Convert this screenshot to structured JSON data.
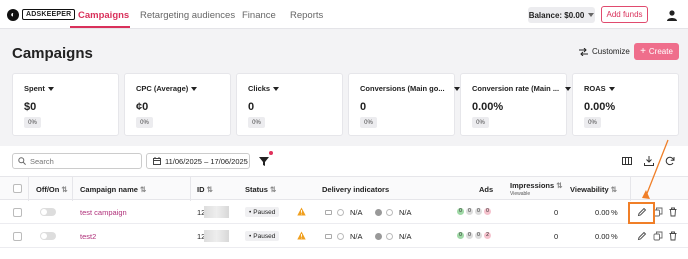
{
  "nav": {
    "logo_text": "ADSKEEPER",
    "tabs": [
      "Campaigns",
      "Retargeting audiences",
      "Finance",
      "Reports"
    ],
    "active_tab": "Campaigns",
    "balance": "Balance: $0.00",
    "add_funds": "Add funds"
  },
  "page": {
    "title": "Campaigns",
    "customize": "Customize",
    "create": "Create"
  },
  "stats": [
    {
      "title": "Spent",
      "value": "$0",
      "pct": "0%"
    },
    {
      "title": "CPC (Average)",
      "value": "¢0",
      "pct": "0%"
    },
    {
      "title": "Clicks",
      "value": "0",
      "pct": "0%"
    },
    {
      "title": "Conversions (Main go...",
      "value": "0",
      "pct": "0%"
    },
    {
      "title": "Conversion rate (Main ...",
      "value": "0.00%",
      "pct": "0%"
    },
    {
      "title": "ROAS",
      "value": "0.00%",
      "pct": "0%"
    }
  ],
  "filters": {
    "search_placeholder": "Search",
    "date_range": "11/06/2025 – 17/06/2025"
  },
  "columns": {
    "offon": "Off/On",
    "name": "Campaign name",
    "id": "ID",
    "status": "Status",
    "delivery": "Delivery indicators",
    "ads": "Ads",
    "impressions": "Impressions",
    "impressions_sub": "Viewable",
    "viewability": "Viewability"
  },
  "rows": [
    {
      "name": "test campaign",
      "id": "12",
      "status": "Paused",
      "na1": "N/A",
      "na2": "N/A",
      "ads": [
        "0",
        "0",
        "0",
        "0"
      ],
      "impressions": "0",
      "viewability": "0.00",
      "pct_sign": "%"
    },
    {
      "name": "test2",
      "id": "12",
      "status": "Paused",
      "na1": "N/A",
      "na2": "N/A",
      "ads": [
        "0",
        "0",
        "0",
        "2"
      ],
      "impressions": "0",
      "viewability": "0.00",
      "pct_sign": "%"
    }
  ],
  "colors": {
    "accent": "#d9315b",
    "highlight": "#f07f28"
  }
}
